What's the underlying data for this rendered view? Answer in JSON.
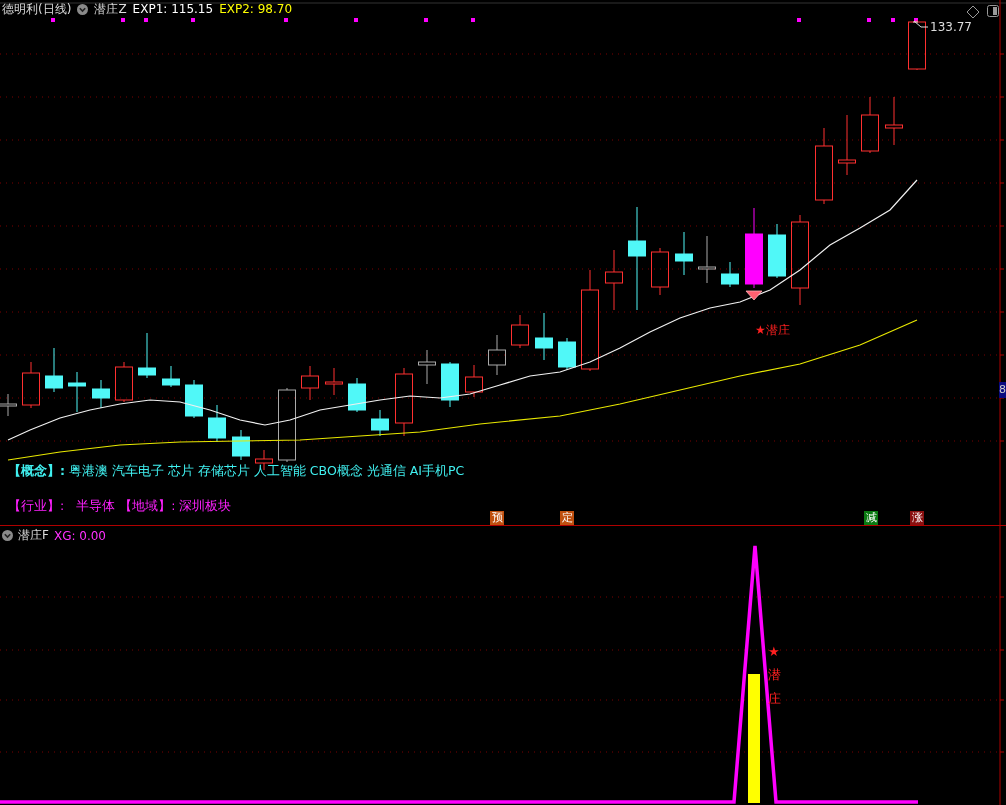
{
  "main_panel": {
    "stock_title": "德明利(日线)",
    "indicator_name": "潜庄Z",
    "readings": [
      {
        "label": "EXP1: 115.15",
        "color": "#ffffff"
      },
      {
        "label": "EXP2: 98.70",
        "color": "#ffff00"
      }
    ],
    "high_label": "133.77",
    "signal_label": "★潜庄",
    "axis_label": "8",
    "concepts": {
      "label": "【概念】:",
      "value": "粤港澳 汽车电子 芯片 存储芯片 人工智能 CBO概念 光通信 AI手机PC"
    },
    "industry": {
      "label": "【行业】:",
      "value": "半导体"
    },
    "region": {
      "label": "【地域】:",
      "value": "深圳板块"
    },
    "signals": [
      {
        "text": "预",
        "color": "#c0500f"
      },
      {
        "text": "定",
        "color": "#c0500f"
      },
      {
        "text": "减",
        "color": "#0a7a12"
      },
      {
        "text": "涨",
        "color": "#8a1010"
      }
    ]
  },
  "sub_panel": {
    "indicator_name": "潜庄F",
    "reading": "XG: 0.00",
    "marker_text": "★潜庄"
  }
}
